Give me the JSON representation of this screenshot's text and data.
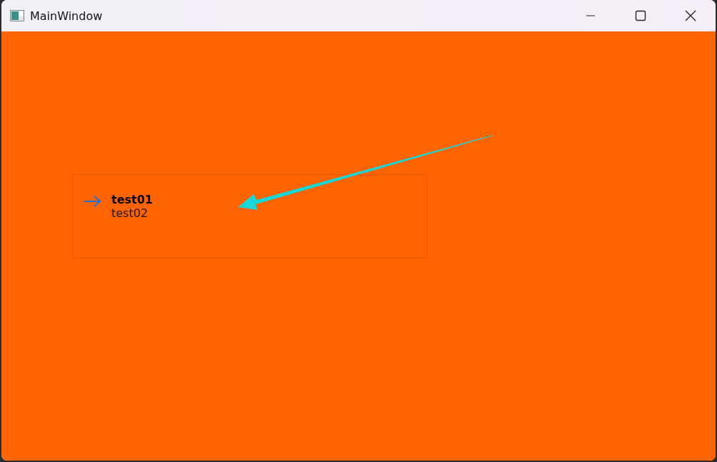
{
  "window": {
    "title": "MainWindow"
  },
  "item": {
    "title": "test01",
    "subtitle": "test02"
  }
}
